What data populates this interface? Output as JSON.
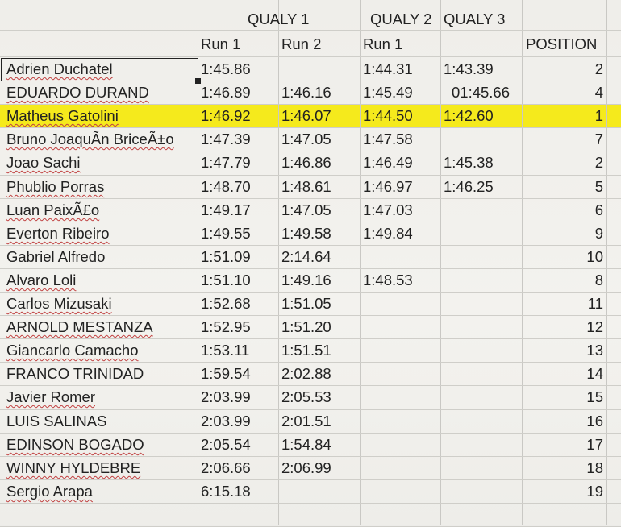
{
  "headers": {
    "qualy1": "QUALY 1",
    "qualy2": "QUALY 2",
    "qualy3": "QUALY 3",
    "run1": "Run 1",
    "run2": "Run 2",
    "q2run1": "Run 1",
    "position": "POSITION"
  },
  "rows": [
    {
      "name": "Adrien Duchatel",
      "q1r1": "1:45.86",
      "q1r2": "",
      "q2": "1:44.31",
      "q3": "1:43.39",
      "pos": "2"
    },
    {
      "name": "EDUARDO DURAND",
      "q1r1": "1:46.89",
      "q1r2": "1:46.16",
      "q2": "1:45.49",
      "q3": "01:45.66",
      "pos": "4"
    },
    {
      "name": "Matheus Gatolini",
      "q1r1": "1:46.92",
      "q1r2": "1:46.07",
      "q2": "1:44.50",
      "q3": "1:42.60",
      "pos": "1"
    },
    {
      "name": "Bruno JoaquÃn BriceÃ±o",
      "q1r1": "1:47.39",
      "q1r2": "1:47.05",
      "q2": "1:47.58",
      "q3": "",
      "pos": "7"
    },
    {
      "name": "Joao Sachi",
      "q1r1": "1:47.79",
      "q1r2": "1:46.86",
      "q2": "1:46.49",
      "q3": "1:45.38",
      "pos": "2"
    },
    {
      "name": "Phublio Porras",
      "q1r1": "1:48.70",
      "q1r2": "1:48.61",
      "q2": "1:46.97",
      "q3": "1:46.25",
      "pos": "5"
    },
    {
      "name": "Luan PaixÃ£o",
      "q1r1": "1:49.17",
      "q1r2": "1:47.05",
      "q2": "1:47.03",
      "q3": "",
      "pos": "6"
    },
    {
      "name": "Everton Ribeiro",
      "q1r1": "1:49.55",
      "q1r2": "1:49.58",
      "q2": "1:49.84",
      "q3": "",
      "pos": "9"
    },
    {
      "name": "Gabriel Alfredo",
      "q1r1": "1:51.09",
      "q1r2": "2:14.64",
      "q2": "",
      "q3": "",
      "pos": "10"
    },
    {
      "name": "Alvaro Loli",
      "q1r1": "1:51.10",
      "q1r2": "1:49.16",
      "q2": "1:48.53",
      "q3": "",
      "pos": "8"
    },
    {
      "name": "Carlos Mizusaki",
      "q1r1": "1:52.68",
      "q1r2": "1:51.05",
      "q2": "",
      "q3": "",
      "pos": "11"
    },
    {
      "name": "ARNOLD MESTANZA",
      "q1r1": "1:52.95",
      "q1r2": "1:51.20",
      "q2": "",
      "q3": "",
      "pos": "12"
    },
    {
      "name": "Giancarlo Camacho",
      "q1r1": "1:53.11",
      "q1r2": "1:51.51",
      "q2": "",
      "q3": "",
      "pos": "13"
    },
    {
      "name": "FRANCO TRINIDAD",
      "q1r1": "1:59.54",
      "q1r2": "2:02.88",
      "q2": "",
      "q3": "",
      "pos": "14"
    },
    {
      "name": "Javier Romer",
      "q1r1": "2:03.99",
      "q1r2": "2:05.53",
      "q2": "",
      "q3": "",
      "pos": "15"
    },
    {
      "name": "LUIS  SALINAS",
      "q1r1": "2:03.99",
      "q1r2": "2:01.51",
      "q2": "",
      "q3": "",
      "pos": "16"
    },
    {
      "name": "EDINSON BOGADO",
      "q1r1": "2:05.54",
      "q1r2": "1:54.84",
      "q2": "",
      "q3": "",
      "pos": "17"
    },
    {
      "name": "WINNY HYLDEBRE",
      "q1r1": "2:06.66",
      "q1r2": "2:06.99",
      "q2": "",
      "q3": "",
      "pos": "18"
    },
    {
      "name": "Sergio Arapa",
      "q1r1": "6:15.18",
      "q1r2": "",
      "q2": "",
      "q3": "",
      "pos": "19"
    }
  ],
  "highlight_color": "#f5ea1c"
}
